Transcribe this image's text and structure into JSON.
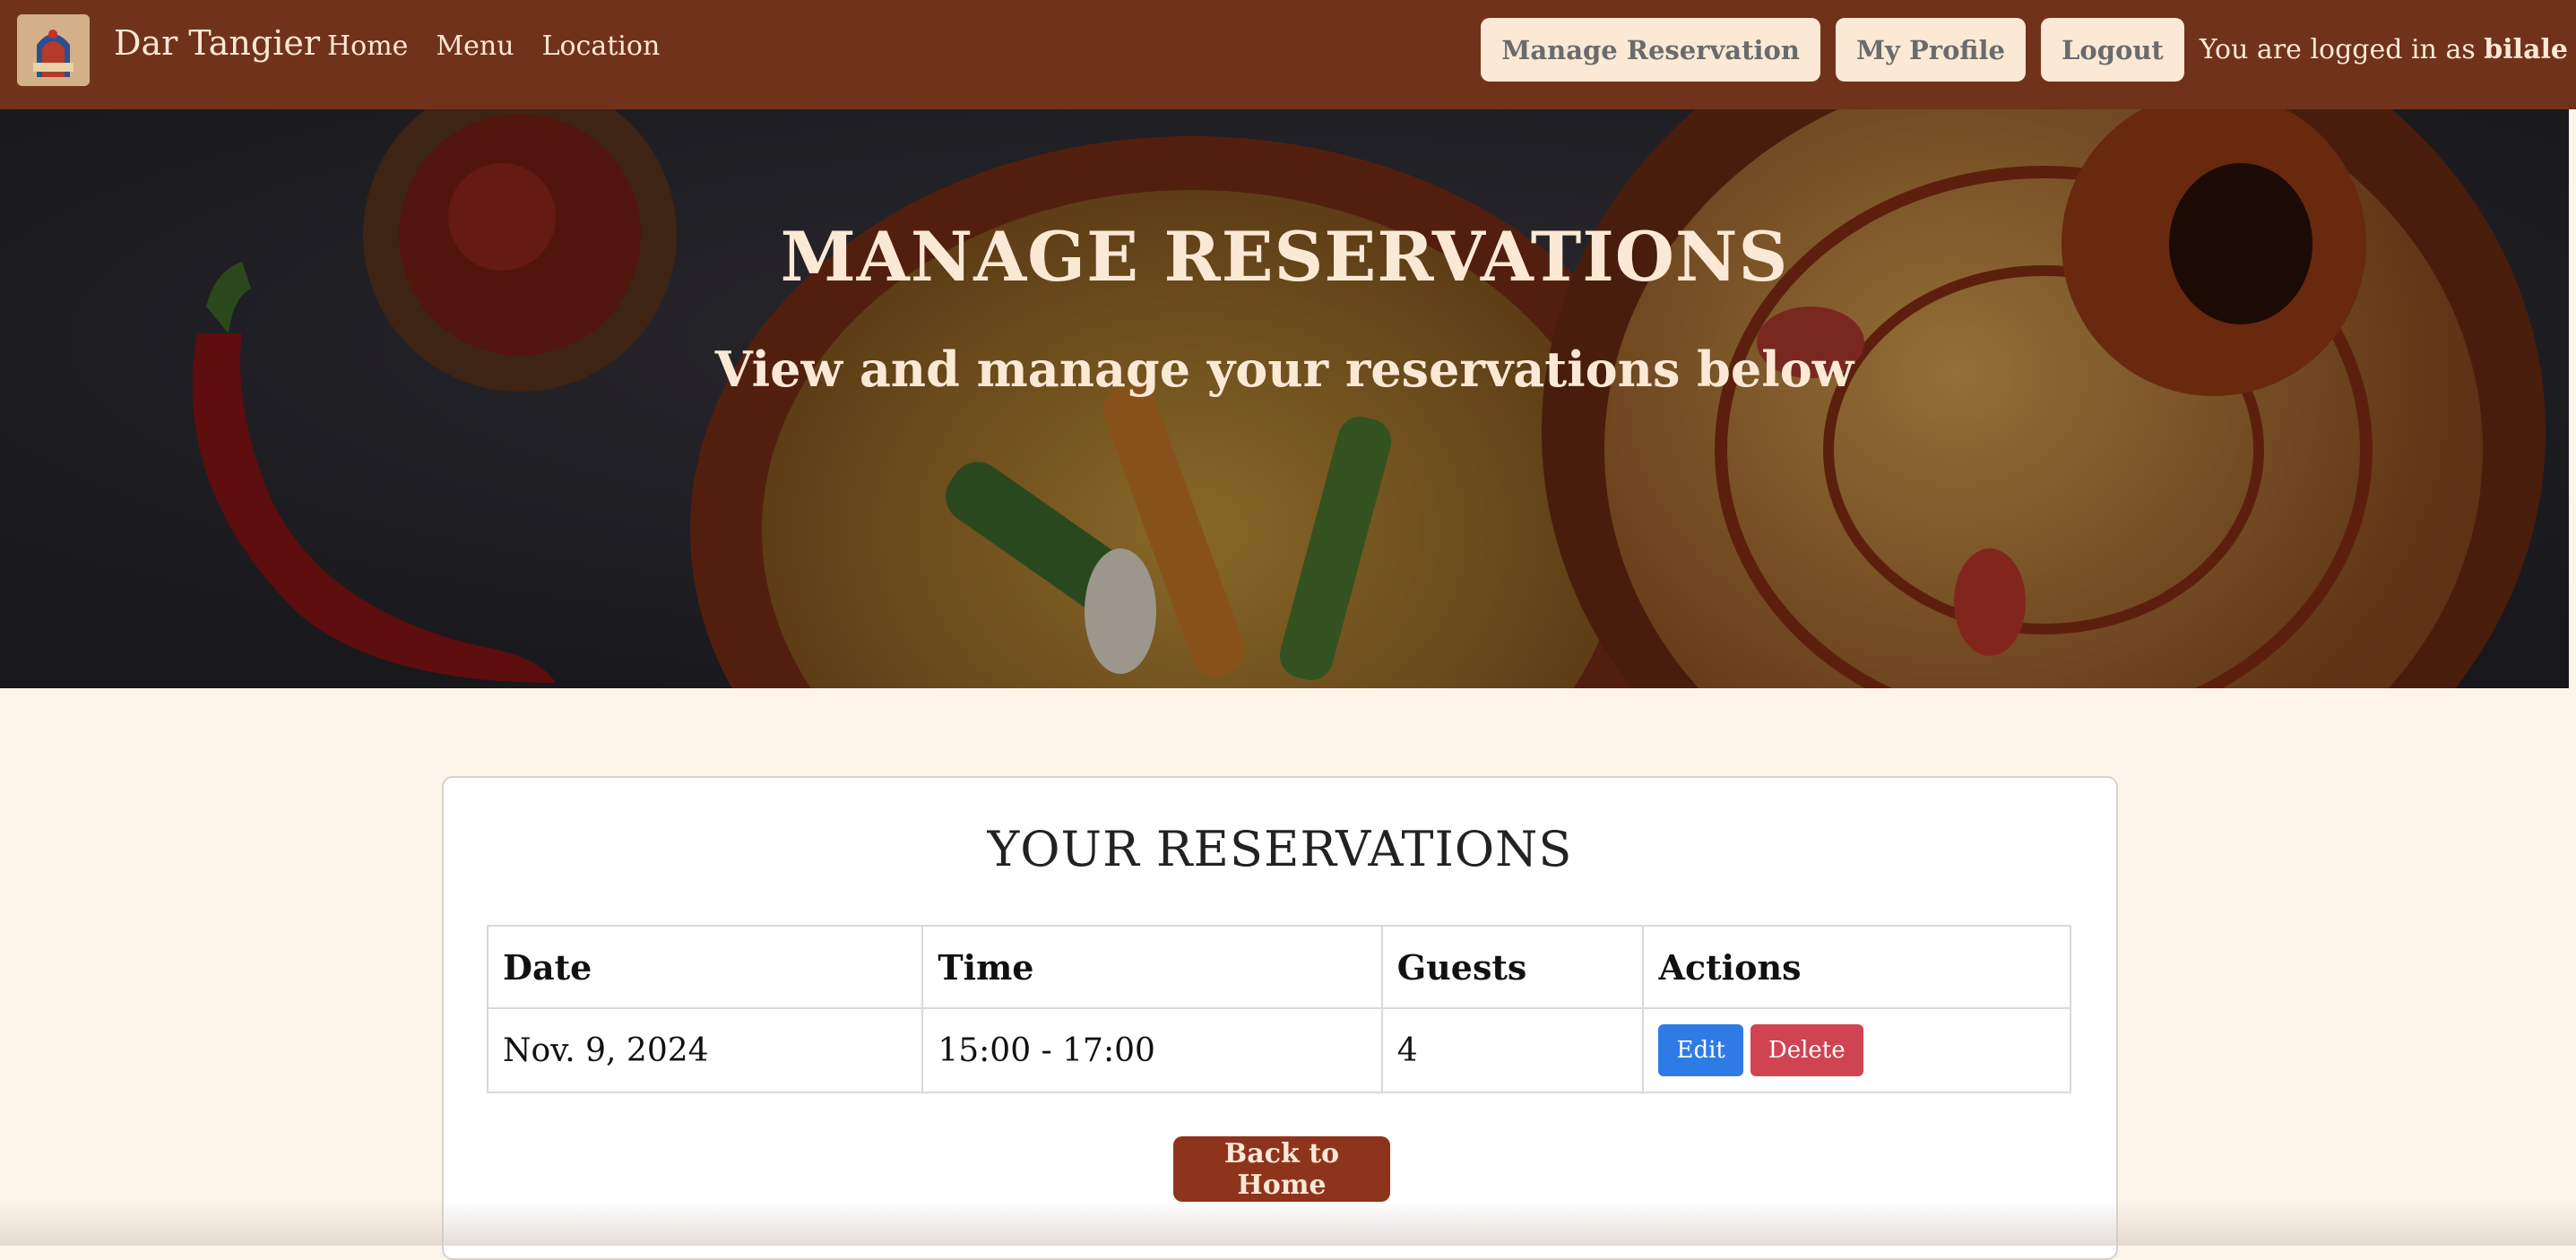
{
  "navbar": {
    "brand_name": "Dar Tangier",
    "brand_logo_text": "TANGIER",
    "links": [
      "Home",
      "Menu",
      "Location"
    ],
    "buttons": {
      "manage_reservation": "Manage Reservation",
      "my_profile": "My Profile",
      "logout": "Logout"
    },
    "logged_in_prefix": "You are logged in as",
    "username": "bilale"
  },
  "hero": {
    "title": "MANAGE RESERVATIONS",
    "subtitle": "View and manage your reservations below"
  },
  "reservations": {
    "title": "YOUR RESERVATIONS",
    "columns": [
      "Date",
      "Time",
      "Guests",
      "Actions"
    ],
    "rows": [
      {
        "date": "Nov. 9, 2024",
        "time": "15:00 - 17:00",
        "guests": "4",
        "edit_label": "Edit",
        "delete_label": "Delete"
      }
    ],
    "back_label": "Back to Home"
  },
  "colors": {
    "navbar": "#71321b",
    "page_bg": "#fdf4ea",
    "cream": "#fbe9d6",
    "edit": "#2f7be6",
    "delete": "#d04452",
    "back_button": "#8f341c"
  }
}
